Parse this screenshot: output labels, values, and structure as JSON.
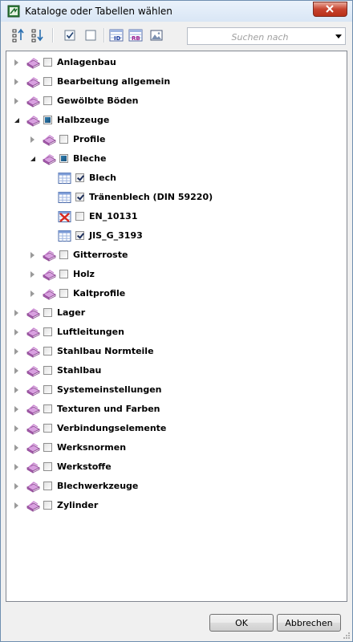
{
  "window": {
    "title": "Kataloge oder Tabellen wählen"
  },
  "toolbar": {
    "buttons": [
      "expand-all-icon",
      "collapse-all-icon",
      "check-all-icon",
      "uncheck-all-icon",
      "id-view-icon",
      "rb-view-icon",
      "image-icon"
    ],
    "search_placeholder": "Suchen nach"
  },
  "tree": [
    {
      "label": "Anlagenbau",
      "level": 0,
      "icon": "book-icon",
      "expander": "closed",
      "check": "unchecked"
    },
    {
      "label": "Bearbeitung allgemein",
      "level": 0,
      "icon": "book-icon",
      "expander": "closed",
      "check": "unchecked"
    },
    {
      "label": "Gewölbte Böden",
      "level": 0,
      "icon": "book-icon",
      "expander": "closed",
      "check": "unchecked"
    },
    {
      "label": "Halbzeuge",
      "level": 0,
      "icon": "book-icon",
      "expander": "open",
      "check": "partial"
    },
    {
      "label": "Profile",
      "level": 1,
      "icon": "book-icon",
      "expander": "closed",
      "check": "unchecked"
    },
    {
      "label": "Bleche",
      "level": 1,
      "icon": "book-icon",
      "expander": "open",
      "check": "partial"
    },
    {
      "label": "Blech",
      "level": 2,
      "icon": "table-icon",
      "expander": "none",
      "check": "checked"
    },
    {
      "label": "Tränenblech (DIN 59220)",
      "level": 2,
      "icon": "table-icon",
      "expander": "none",
      "check": "checked"
    },
    {
      "label": "EN_10131",
      "level": 2,
      "icon": "table-error-icon",
      "expander": "none",
      "check": "unchecked"
    },
    {
      "label": "JIS_G_3193",
      "level": 2,
      "icon": "table-icon",
      "expander": "none",
      "check": "checked"
    },
    {
      "label": "Gitterroste",
      "level": 1,
      "icon": "book-icon",
      "expander": "closed",
      "check": "unchecked"
    },
    {
      "label": "Holz",
      "level": 1,
      "icon": "book-icon",
      "expander": "closed",
      "check": "unchecked"
    },
    {
      "label": "Kaltprofile",
      "level": 1,
      "icon": "book-icon",
      "expander": "closed",
      "check": "unchecked"
    },
    {
      "label": "Lager",
      "level": 0,
      "icon": "book-icon",
      "expander": "closed",
      "check": "unchecked"
    },
    {
      "label": "Luftleitungen",
      "level": 0,
      "icon": "book-icon",
      "expander": "closed",
      "check": "unchecked"
    },
    {
      "label": "Stahlbau Normteile",
      "level": 0,
      "icon": "book-icon",
      "expander": "closed",
      "check": "unchecked"
    },
    {
      "label": "Stahlbau",
      "level": 0,
      "icon": "book-icon",
      "expander": "closed",
      "check": "unchecked"
    },
    {
      "label": "Systemeinstellungen",
      "level": 0,
      "icon": "book-icon",
      "expander": "closed",
      "check": "unchecked"
    },
    {
      "label": "Texturen und Farben",
      "level": 0,
      "icon": "book-icon",
      "expander": "closed",
      "check": "unchecked"
    },
    {
      "label": "Verbindungselemente",
      "level": 0,
      "icon": "book-icon",
      "expander": "closed",
      "check": "unchecked"
    },
    {
      "label": "Werksnormen",
      "level": 0,
      "icon": "book-icon",
      "expander": "closed",
      "check": "unchecked"
    },
    {
      "label": "Werkstoffe",
      "level": 0,
      "icon": "book-icon",
      "expander": "closed",
      "check": "unchecked"
    },
    {
      "label": "Blechwerkzeuge",
      "level": 0,
      "icon": "book-icon",
      "expander": "closed",
      "check": "unchecked"
    },
    {
      "label": "Zylinder",
      "level": 0,
      "icon": "book-icon",
      "expander": "closed",
      "check": "unchecked"
    }
  ],
  "footer": {
    "ok_label": "OK",
    "cancel_label": "Abbrechen"
  },
  "colors": {
    "book": "#c87ed0",
    "titlebar": "#dae6f4",
    "close": "#c7432e"
  }
}
